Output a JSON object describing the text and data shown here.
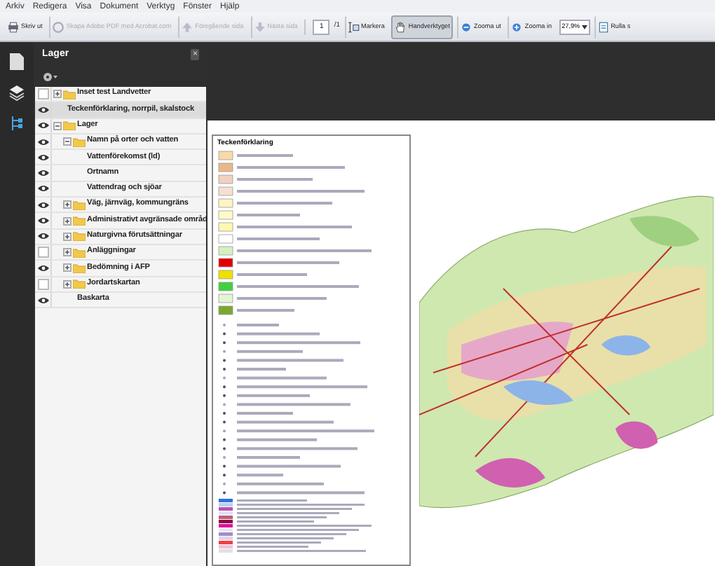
{
  "menu": [
    "Arkiv",
    "Redigera",
    "Visa",
    "Dokument",
    "Verktyg",
    "Fönster",
    "Hjälp"
  ],
  "toolbar": [
    {
      "kind": "print",
      "label": "Skriv ut",
      "disabled": false,
      "selected": false
    },
    {
      "kind": "pdf",
      "label": "Skapa Adobe PDF med Acrobat.com",
      "disabled": true,
      "selected": false
    },
    {
      "kind": "prev",
      "label": "Föregående sida",
      "disabled": true,
      "selected": false
    },
    {
      "kind": "next",
      "label": "Nästa sida",
      "disabled": true,
      "selected": false
    },
    {
      "kind": "page",
      "value": "1",
      "total": "/1"
    },
    {
      "kind": "select",
      "label": "Markera",
      "disabled": false,
      "selected": false
    },
    {
      "kind": "hand",
      "label": "Handverktyget",
      "disabled": false,
      "selected": true
    },
    {
      "kind": "zoomout",
      "label": "Zooma ut",
      "disabled": false,
      "selected": false
    },
    {
      "kind": "zoomin",
      "label": "Zooma in",
      "disabled": false,
      "selected": false
    },
    {
      "kind": "zoom",
      "value": "27,9%"
    },
    {
      "kind": "scroll",
      "label": "Rulla s",
      "disabled": false,
      "selected": false
    }
  ],
  "panel": {
    "title": "Lager",
    "close": "×"
  },
  "layers": [
    {
      "kind": "folder",
      "name": "Inset test Landvetter",
      "visible": false,
      "expanded": false,
      "selected": false
    },
    {
      "kind": "layer",
      "name": "Teckenförklaring, norrpil, skalstock",
      "visible": true,
      "selected": true
    },
    {
      "kind": "folder",
      "name": "Lager",
      "visible": true,
      "expanded": true,
      "selected": false,
      "children": [
        {
          "kind": "folder",
          "name": "Namn på orter och vatten",
          "visible": true,
          "expanded": true,
          "selected": false,
          "children": [
            {
              "kind": "layer",
              "name": "Vattenförekomst (ld)",
              "visible": true,
              "selected": false
            },
            {
              "kind": "layer",
              "name": "Ortnamn",
              "visible": true,
              "selected": false
            },
            {
              "kind": "layer",
              "name": "Vattendrag och sjöar",
              "visible": true,
              "selected": false
            }
          ]
        },
        {
          "kind": "folder",
          "name": "Väg, järnväg, kommungräns",
          "visible": true,
          "expanded": false,
          "selected": false
        },
        {
          "kind": "folder",
          "name": "Administrativt avgränsade områd",
          "visible": true,
          "expanded": false,
          "selected": false
        },
        {
          "kind": "folder",
          "name": "Naturgivna förutsättningar",
          "visible": true,
          "expanded": false,
          "selected": false
        },
        {
          "kind": "folder",
          "name": "Anläggningar",
          "visible": false,
          "expanded": false,
          "selected": false
        },
        {
          "kind": "folder",
          "name": "Bedömning i AFP",
          "visible": true,
          "expanded": false,
          "selected": false
        },
        {
          "kind": "folder",
          "name": "Jordartskartan",
          "visible": false,
          "expanded": false,
          "selected": false
        },
        {
          "kind": "layer",
          "name": "Baskarta",
          "visible": true,
          "selected": false
        }
      ]
    }
  ],
  "legend": {
    "title": "Teckenförklaring"
  }
}
